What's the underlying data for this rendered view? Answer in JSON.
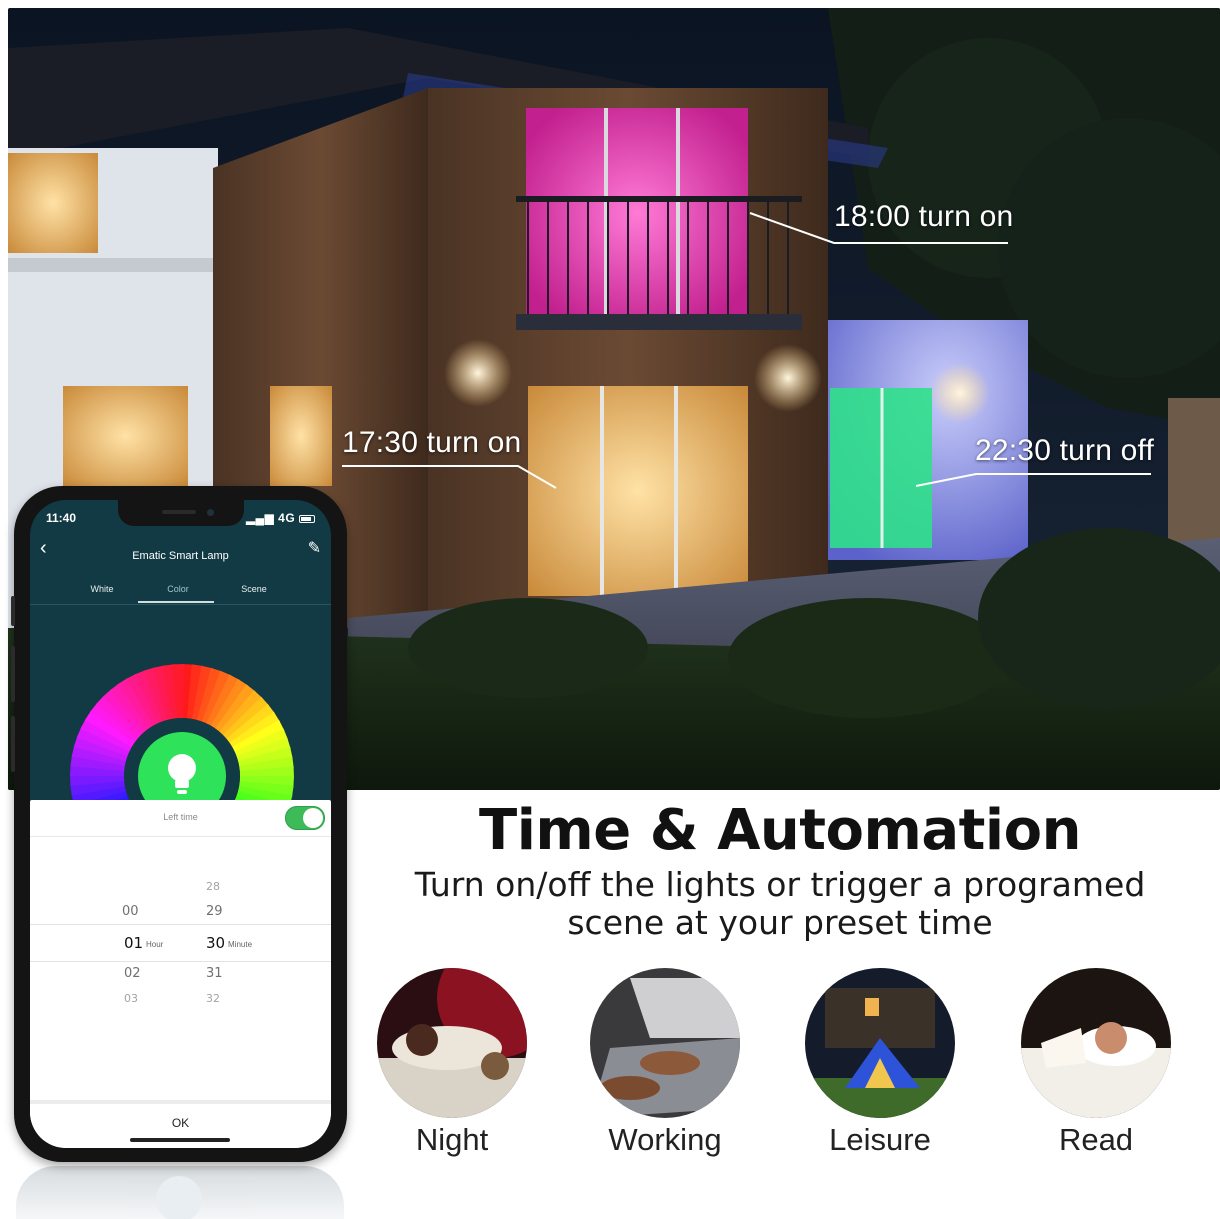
{
  "scene": {
    "callouts": [
      {
        "id": "balcony",
        "text": "18:00 turn on"
      },
      {
        "id": "kitchen",
        "text": "17:30 turn on"
      },
      {
        "id": "annex",
        "text": "22:30 turn off"
      }
    ]
  },
  "headline": "Time & Automation",
  "subline": {
    "line1": "Turn on/off the lights or trigger a programed",
    "line2": "scene at your preset time"
  },
  "modes": [
    {
      "label": "Night",
      "icon": "sleeping-person-icon"
    },
    {
      "label": "Working",
      "icon": "laptop-typing-icon"
    },
    {
      "label": "Leisure",
      "icon": "camping-tent-icon"
    },
    {
      "label": "Read",
      "icon": "reading-in-bed-icon"
    }
  ],
  "phone": {
    "status": {
      "time": "11:40",
      "signal": "4G"
    },
    "app_title": "Ematic Smart Lamp",
    "tabs": [
      {
        "label": "White"
      },
      {
        "label": "Color",
        "active": true
      },
      {
        "label": "Scene"
      }
    ],
    "sheet": {
      "title": "Left time",
      "toggle_on": true,
      "hours": {
        "above2": "",
        "above1": "00",
        "selected": "01",
        "below1": "02",
        "below2": "03",
        "unit": "Hour"
      },
      "minutes": {
        "above3": "28",
        "above2": "29",
        "selected": "30",
        "below1": "31",
        "below2": "32",
        "unit": "Minute"
      },
      "ok_label": "OK"
    }
  },
  "colors": {
    "app_bg": "#123a44",
    "toggle_green": "#3dbb59",
    "bulb_green": "#2ee35a"
  }
}
